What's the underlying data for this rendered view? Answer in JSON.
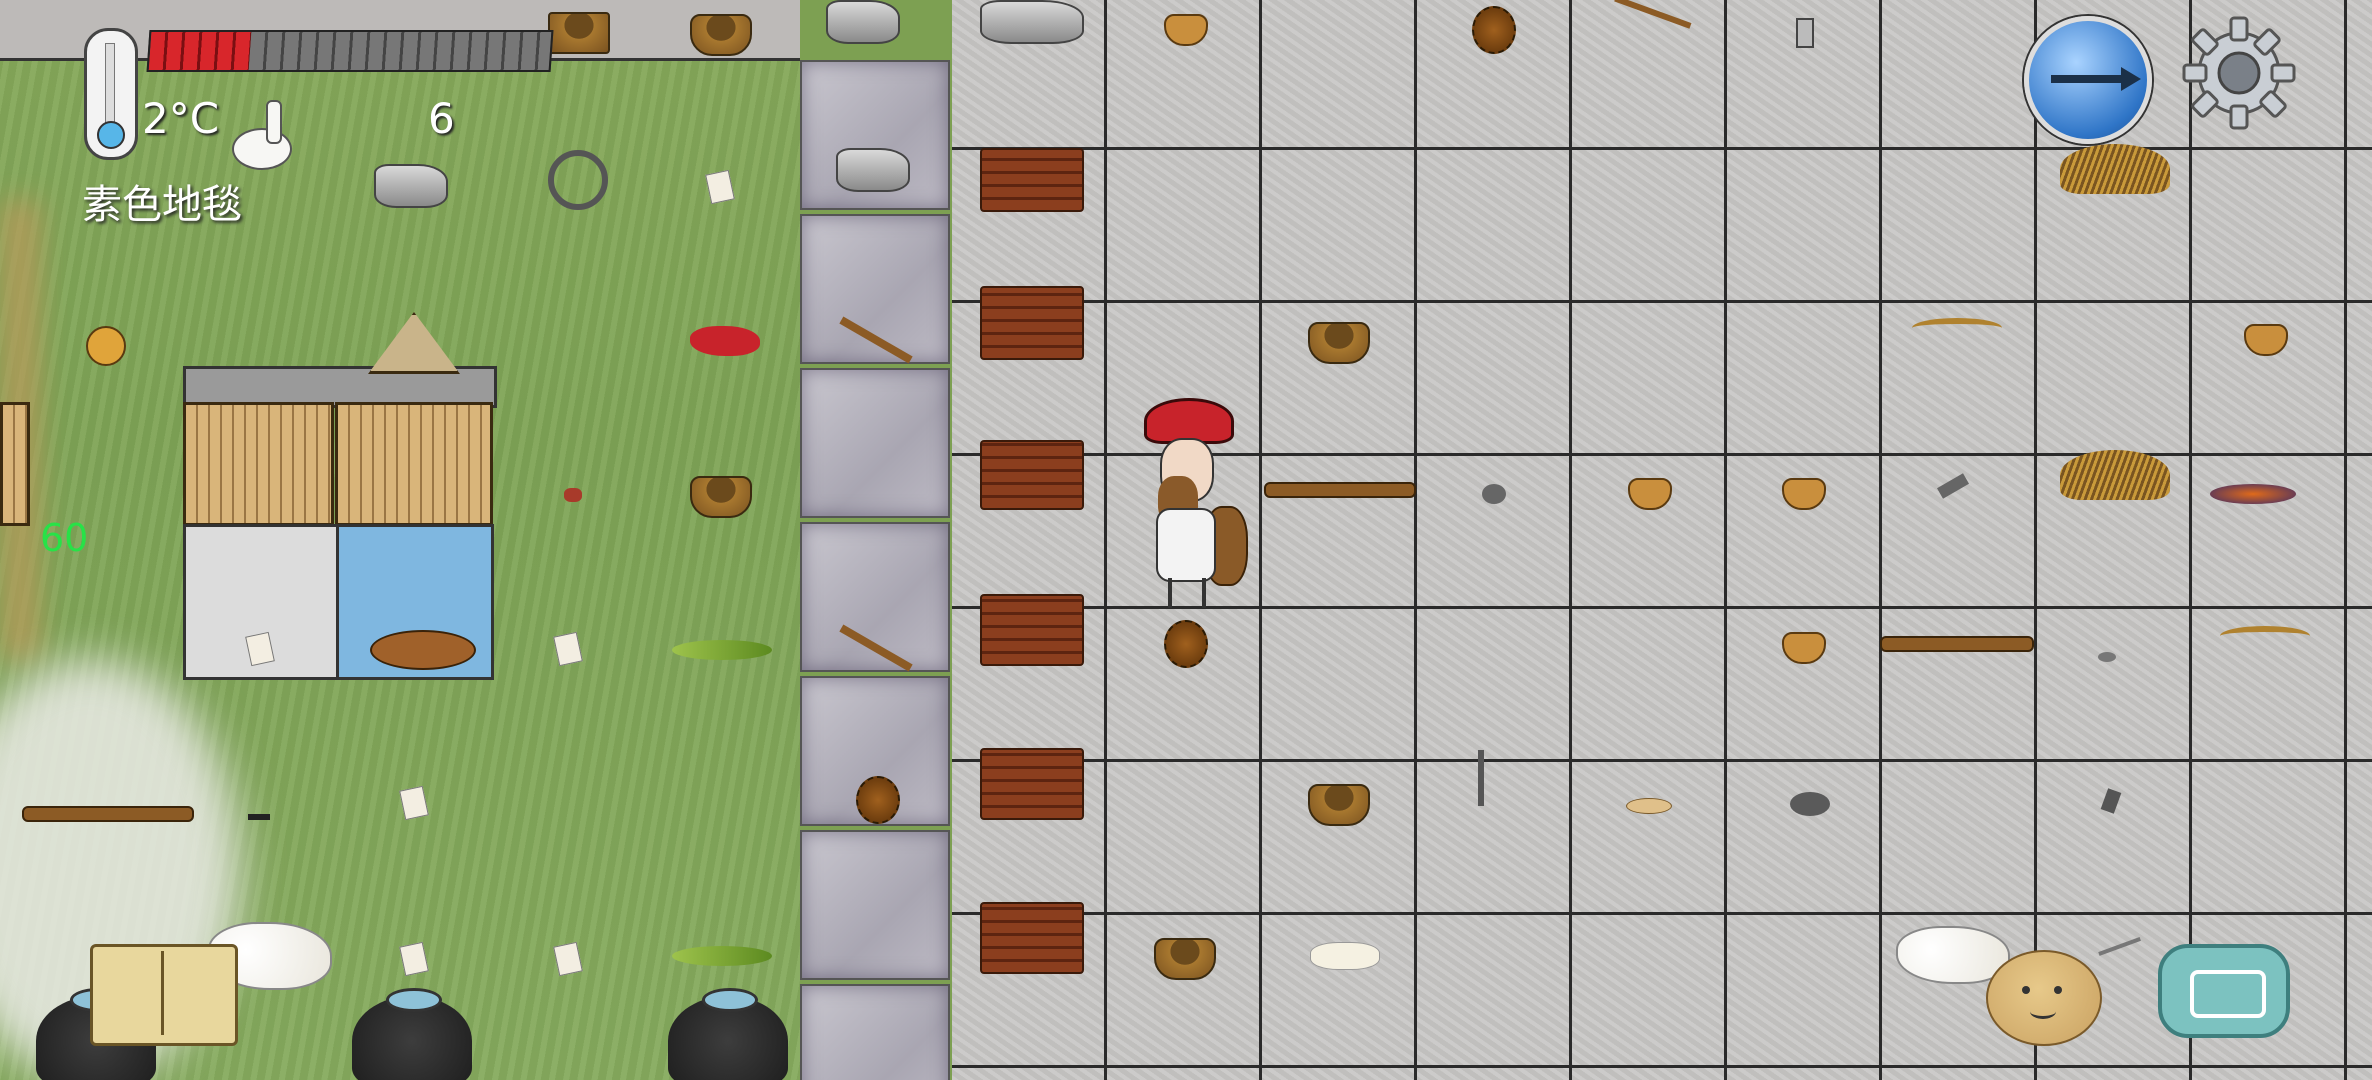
{
  "hud": {
    "temperature": "2°C",
    "held_count": "6",
    "tile_name": "素色地毯",
    "fps": "60",
    "food_meter": 0.25
  },
  "icons": {
    "thermometer": "thermometer-icon",
    "compass": "compass-icon",
    "settings": "gear-icon",
    "tech_book": "book-icon",
    "emote": "potato-face-icon",
    "keyboard": "keyboard-icon"
  },
  "colors": {
    "food_fill": "#d8262b",
    "food_empty": "#777777",
    "fps_text": "#27e247"
  }
}
